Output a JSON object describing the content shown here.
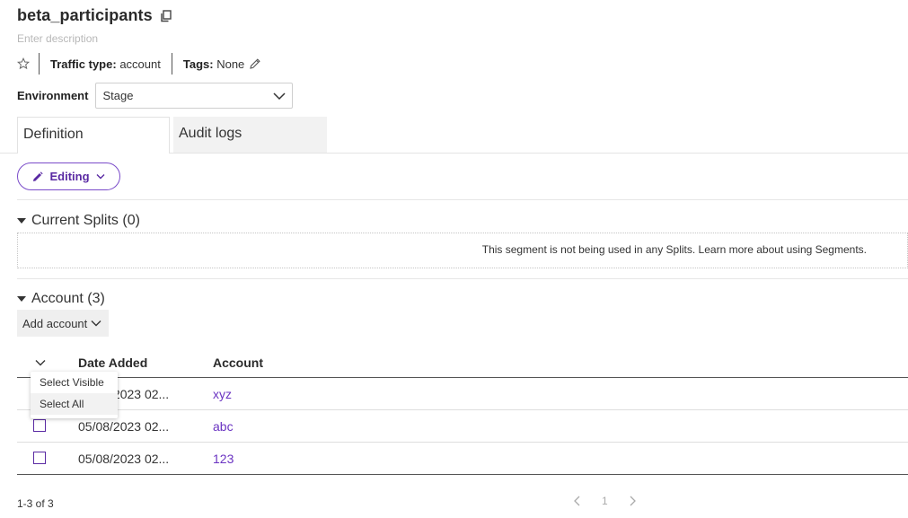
{
  "header": {
    "title": "beta_participants",
    "description_placeholder": "Enter description",
    "traffic_type_label": "Traffic type:",
    "traffic_type_value": "account",
    "tags_label": "Tags:",
    "tags_value": "None"
  },
  "environment": {
    "label": "Environment",
    "selected": "Stage"
  },
  "tabs": [
    {
      "label": "Definition",
      "active": true
    },
    {
      "label": "Audit logs",
      "active": false
    }
  ],
  "editing_button": {
    "label": "Editing"
  },
  "splits_section": {
    "title": "Current Splits (0)",
    "empty_message": "This segment is not being used in any Splits. Learn more about using Segments."
  },
  "account_section": {
    "title": "Account (3)",
    "add_button": "Add account",
    "columns": [
      "Date Added",
      "Account"
    ],
    "rows": [
      {
        "date": "05/08/2023 02...",
        "account": "xyz"
      },
      {
        "date": "05/08/2023 02...",
        "account": "abc"
      },
      {
        "date": "05/08/2023 02...",
        "account": "123"
      }
    ],
    "select_menu": [
      "Select Visible",
      "Select All"
    ],
    "count_text": "1-3 of 3",
    "page": "1"
  },
  "colors": {
    "accent": "#6b34c2",
    "button_border": "#7a4bc9"
  }
}
